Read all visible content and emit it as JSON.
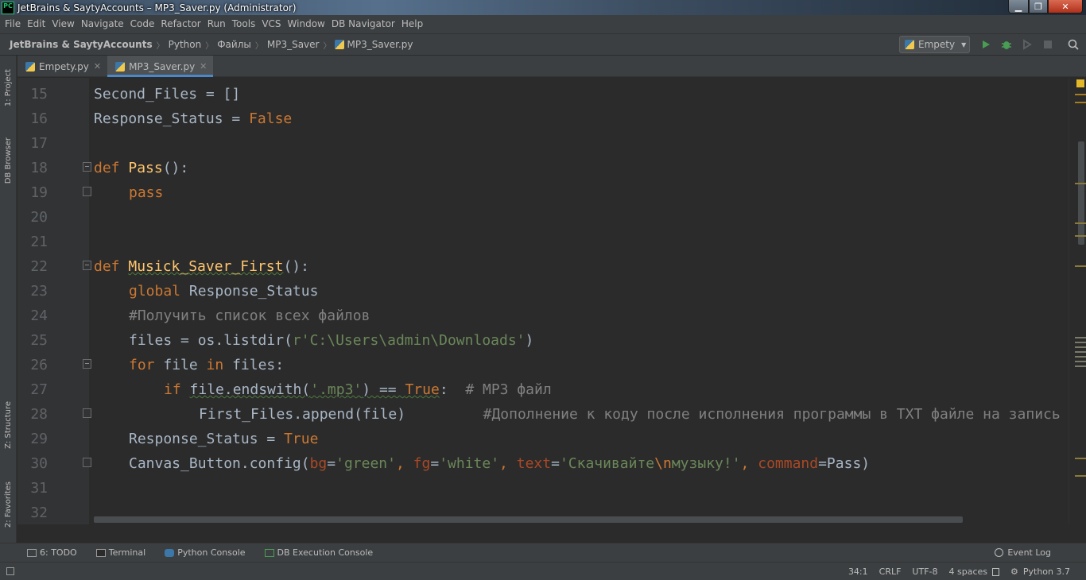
{
  "window": {
    "title": "JetBrains & SaytyAccounts – MP3_Saver.py (Administrator)",
    "logo": "PC"
  },
  "menu": [
    "File",
    "Edit",
    "View",
    "Navigate",
    "Code",
    "Refactor",
    "Run",
    "Tools",
    "VCS",
    "Window",
    "DB Navigator",
    "Help"
  ],
  "breadcrumb": [
    "JetBrains & SaytyAccounts",
    "Python",
    "Файлы",
    "MP3_Saver",
    "MP3_Saver.py"
  ],
  "run_config": "Empety",
  "left_tool_tabs": {
    "project": "1: Project",
    "db_browser": "DB Browser",
    "structure": "Z: Structure",
    "favorites": "2: Favorites"
  },
  "tabs": [
    {
      "label": "Empety.py",
      "active": false
    },
    {
      "label": "MP3_Saver.py",
      "active": true
    }
  ],
  "editor": {
    "line_numbers": [
      "15",
      "16",
      "17",
      "18",
      "19",
      "20",
      "21",
      "22",
      "23",
      "24",
      "25",
      "26",
      "27",
      "28",
      "29",
      "30",
      "31",
      "32"
    ],
    "tokens": {
      "l15": "Second_Files = []",
      "l16_a": "Response_Status = ",
      "l16_b": "False",
      "l18_kw": "def ",
      "l18_fn": "Pass",
      "l18_rest": "():",
      "l19": "pass",
      "l22_kw": "def ",
      "l22_fn": "Musick_Saver_First",
      "l22_rest": "():",
      "l23_kw": "global ",
      "l23_rest": "Response_Status",
      "l24": "#Получить список всех файлов",
      "l25_a": "files = os.listdir(",
      "l25_str": "r'C:\\Users\\admin\\Downloads'",
      "l25_b": ")",
      "l26_kw1": "for ",
      "l26_a": "file ",
      "l26_kw2": "in ",
      "l26_b": "files:",
      "l27_kw": "if ",
      "l27_a": "file.endswith(",
      "l27_str": "'.mp3'",
      "l27_b": ") == ",
      "l27_true": "True",
      "l27_c": ":  ",
      "l27_cm": "# MP3 файл",
      "l28_a": "First_Files.append(file)         ",
      "l28_cm": "#Дополнение к коду после исполнения программы в TXT файле на запись",
      "l29_a": "Response_Status = ",
      "l29_true": "True",
      "l30_a": "Canvas_Button.config(",
      "l30_p1": "bg",
      "l30_eq1": "=",
      "l30_s1": "'green'",
      "l30_c1": ", ",
      "l30_p2": "fg",
      "l30_eq2": "=",
      "l30_s2": "'white'",
      "l30_c2": ", ",
      "l30_p3": "text",
      "l30_eq3": "=",
      "l30_s3a": "'Скачивайте",
      "l30_esc": "\\n",
      "l30_s3b": "музыку!'",
      "l30_c3": ", ",
      "l30_p4": "command",
      "l30_eq4": "=Pass)"
    }
  },
  "bottom_tools": [
    {
      "label": "6: TODO",
      "icon": "todo-icon"
    },
    {
      "label": "Terminal",
      "icon": "terminal-icon"
    },
    {
      "label": "Python Console",
      "icon": "python-console-icon"
    },
    {
      "label": "DB Execution Console",
      "icon": "db-console-icon"
    }
  ],
  "event_log": "Event Log",
  "status": {
    "position": "34:1",
    "line_sep": "CRLF",
    "encoding": "UTF-8",
    "indent": "4 spaces",
    "interpreter": "Python 3.7"
  }
}
